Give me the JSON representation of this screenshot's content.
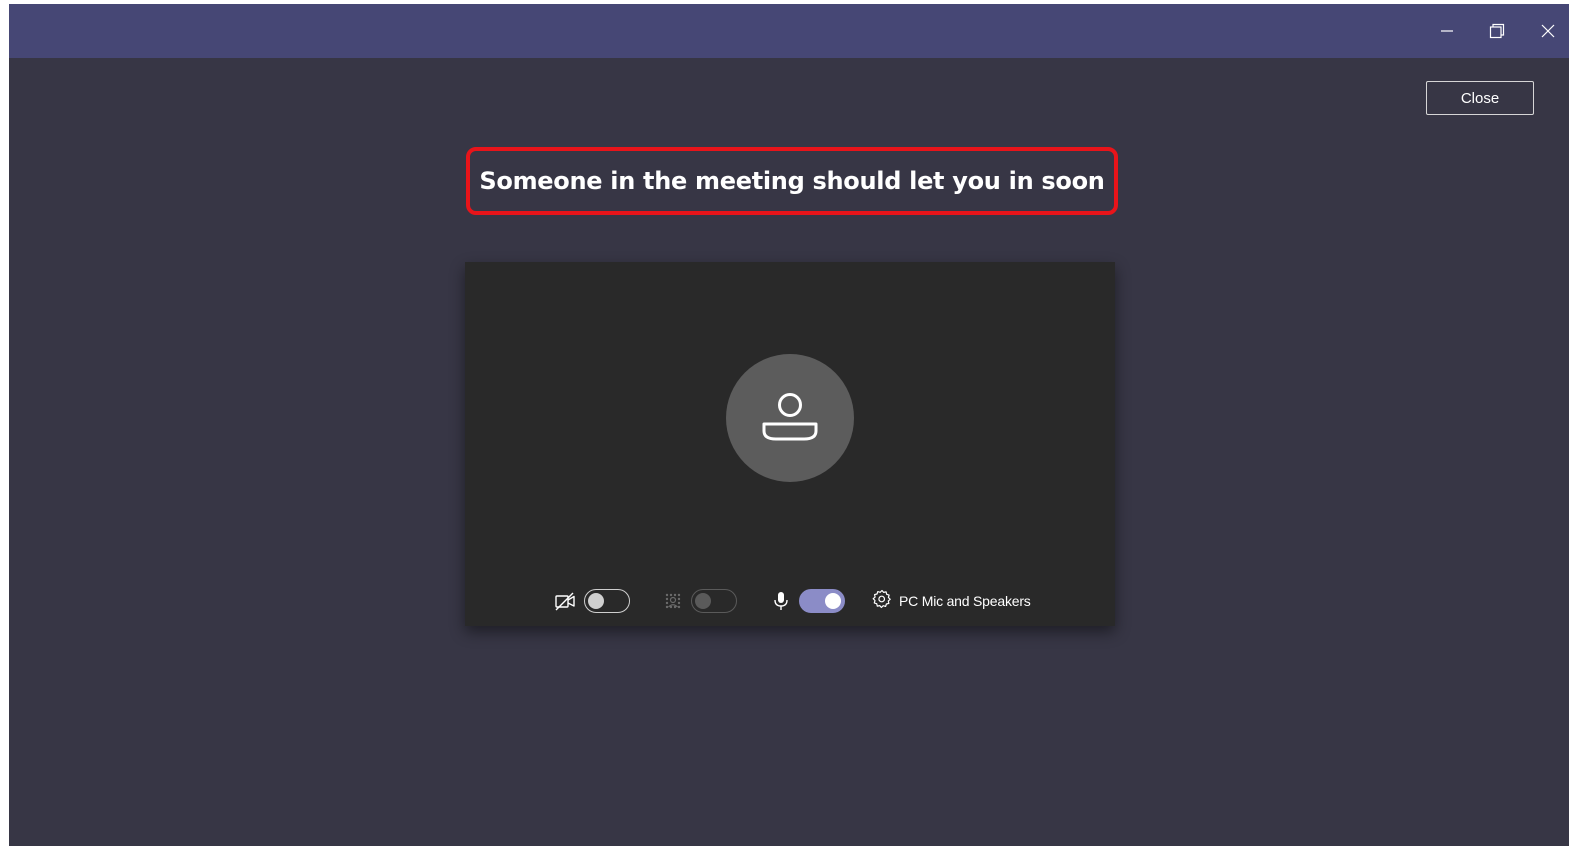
{
  "window": {
    "controls": {
      "minimize_icon": "minimize-icon",
      "maximize_icon": "restore-icon",
      "close_icon": "close-icon"
    },
    "titlebar_color": "#464775",
    "background_color": "#373645"
  },
  "header": {
    "close_label": "Close"
  },
  "lobby": {
    "message": "Someone in the meeting should let you in soon",
    "highlight_color": "#e8141a"
  },
  "preview": {
    "avatar_icon": "person-icon",
    "camera": {
      "icon": "camera-off-icon",
      "enabled": false
    },
    "background_blur": {
      "icon": "background-blur-icon",
      "enabled": false,
      "disabled": true
    },
    "microphone": {
      "icon": "microphone-icon",
      "enabled": true
    },
    "device_settings": {
      "icon": "gear-icon",
      "label": "PC Mic and Speakers"
    },
    "toggle_on_color": "#8b8cc7"
  }
}
